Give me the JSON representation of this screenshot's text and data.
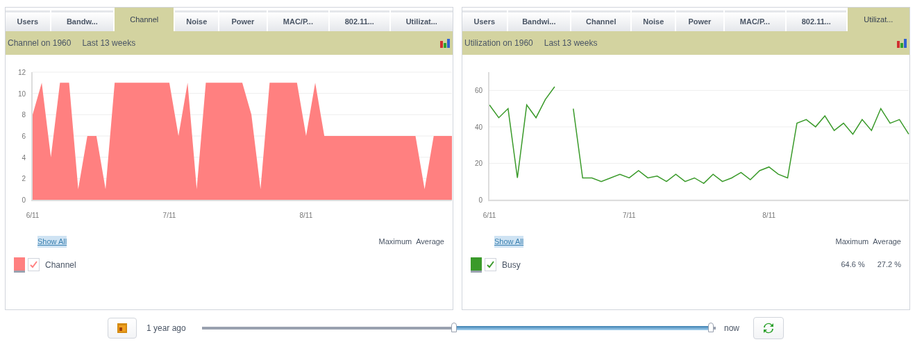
{
  "panels": [
    {
      "tabs": [
        {
          "label": "Users",
          "selected": false
        },
        {
          "label": "Bandw...",
          "selected": false
        },
        {
          "label": "Channel",
          "selected": true
        },
        {
          "label": "Noise",
          "selected": false
        },
        {
          "label": "Power",
          "selected": false
        },
        {
          "label": "MAC/P...",
          "selected": false
        },
        {
          "label": "802.11...",
          "selected": false
        },
        {
          "label": "Utilizat...",
          "selected": false
        }
      ],
      "header": {
        "title": "Channel on 1960",
        "period": "Last 13 weeks"
      },
      "chart_data": {
        "type": "area",
        "categories": [
          "6/11",
          null,
          null,
          null,
          null,
          null,
          null,
          null,
          null,
          null,
          null,
          null,
          null,
          null,
          null,
          "7/11",
          null,
          null,
          null,
          null,
          null,
          null,
          null,
          null,
          null,
          null,
          null,
          null,
          null,
          null,
          "8/11",
          null,
          null,
          null,
          null,
          null,
          null,
          null,
          null,
          null,
          null,
          null,
          null,
          null,
          null,
          null,
          null
        ],
        "series": [
          {
            "name": "Channel",
            "color": "#ff8080",
            "values": [
              8,
              11,
              4,
              11,
              11,
              1,
              6,
              6,
              1,
              11,
              11,
              11,
              11,
              11,
              11,
              11,
              6,
              11,
              1,
              11,
              11,
              11,
              11,
              11,
              8,
              1,
              11,
              11,
              11,
              11,
              6,
              11,
              6,
              6,
              6,
              6,
              6,
              6,
              6,
              6,
              6,
              6,
              6,
              1,
              6,
              6,
              6
            ]
          }
        ],
        "ylim": [
          0,
          12
        ],
        "yticks": [
          0,
          2,
          4,
          6,
          8,
          10,
          12
        ],
        "grid": true
      },
      "show_all": "Show All",
      "columns": [
        "Maximum",
        "Average"
      ],
      "legend": [
        {
          "checked": true
        }
      ]
    },
    {
      "tabs": [
        {
          "label": "Users",
          "selected": false
        },
        {
          "label": "Bandwi...",
          "selected": false
        },
        {
          "label": "Channel",
          "selected": false
        },
        {
          "label": "Noise",
          "selected": false
        },
        {
          "label": "Power",
          "selected": false
        },
        {
          "label": "MAC/P...",
          "selected": false
        },
        {
          "label": "802.11...",
          "selected": false
        },
        {
          "label": "Utilizat...",
          "selected": true
        }
      ],
      "header": {
        "title": "Utilization on 1960",
        "period": "Last 13 weeks"
      },
      "chart_data": {
        "type": "line",
        "categories": [
          "6/11",
          null,
          null,
          null,
          null,
          null,
          null,
          null,
          null,
          null,
          null,
          null,
          null,
          null,
          null,
          "7/11",
          null,
          null,
          null,
          null,
          null,
          null,
          null,
          null,
          null,
          null,
          null,
          null,
          null,
          null,
          "8/11",
          null,
          null,
          null,
          null,
          null,
          null,
          null,
          null,
          null,
          null,
          null,
          null,
          null,
          null,
          null
        ],
        "series": [
          {
            "name": "Busy",
            "color": "#3a9a2a",
            "values": [
              52,
              45,
              50,
              12,
              52,
              45,
              55,
              62,
              null,
              50,
              12,
              12,
              10,
              12,
              14,
              12,
              16,
              12,
              13,
              10,
              14,
              10,
              12,
              9,
              14,
              10,
              12,
              15,
              11,
              16,
              18,
              14,
              12,
              42,
              44,
              40,
              46,
              38,
              42,
              36,
              44,
              38,
              50,
              42,
              44,
              36
            ]
          }
        ],
        "ylim": [
          0,
          70
        ],
        "yticks": [
          0,
          20,
          40,
          60
        ],
        "grid": true
      },
      "show_all": "Show All",
      "columns": [
        "Maximum",
        "Average"
      ],
      "legend": [
        {
          "checked": true,
          "maximum": "64.6 %",
          "average": "27.2 %"
        }
      ]
    }
  ],
  "time_range": {
    "from_label": "1 year ago",
    "to_label": "now"
  }
}
